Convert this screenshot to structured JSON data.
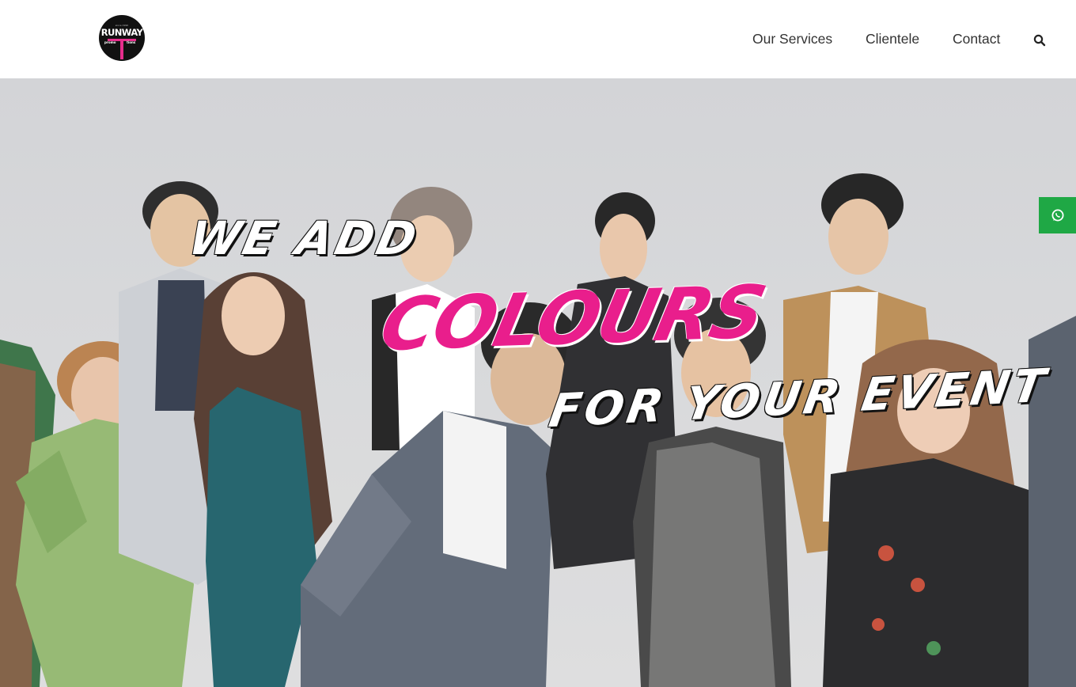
{
  "brand": {
    "name": "RUNWAY",
    "since": "since 1990",
    "sub_left": "promo",
    "sub_right": "tions",
    "accent": "#e62d8c"
  },
  "nav": {
    "items": [
      "Our Services",
      "Clientele",
      "Contact"
    ],
    "search_icon": "search-icon"
  },
  "hero": {
    "line1": "WE ADD",
    "line2": "COLOURS",
    "line3": "FOR YOUR EVENT",
    "accent": "#e91e8c"
  },
  "whatsapp": {
    "icon": "whatsapp-icon",
    "color": "#1fa845"
  }
}
